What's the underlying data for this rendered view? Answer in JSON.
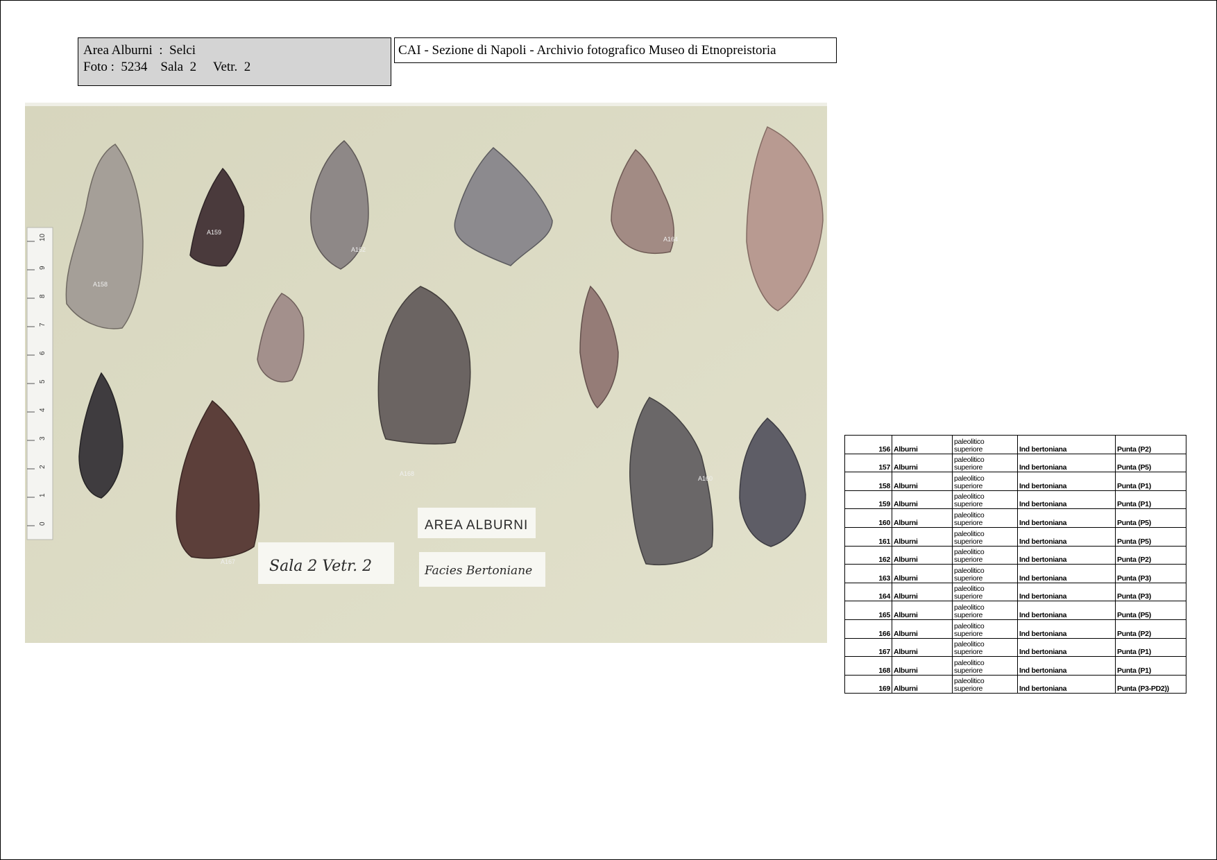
{
  "header": {
    "area_line": {
      "area_label": "Area Alburni",
      "sep": ":",
      "material": "Selci"
    },
    "photo_line": {
      "foto_label": "Foto :",
      "foto_num": "5234",
      "sala_label": "Sala",
      "sala_num": "2",
      "vetr_label": "Vetr.",
      "vetr_num": "2"
    },
    "archive": "CAI - Sezione di Napoli  - Archivio fotografico Museo di Etnopreistoria"
  },
  "photo": {
    "labels": {
      "card_area": "AREA ALBURNI",
      "card_sala": "Sala 2  Vetr. 2",
      "card_facies": "Facies Bertoniane"
    },
    "ruler_ticks": [
      "0",
      "1",
      "2",
      "3",
      "4",
      "5",
      "6",
      "7",
      "8",
      "9",
      "10"
    ],
    "artifact_codes": [
      "A158",
      "A159",
      "A162",
      "A164",
      "A167",
      "A168",
      "A160"
    ]
  },
  "catalog": {
    "rows": [
      {
        "num": "156",
        "site": "Alburni",
        "period_a": "paleolitico",
        "period_b": "superiore",
        "industry": "Ind bertoniana",
        "type": "Punta (P2)"
      },
      {
        "num": "157",
        "site": "Alburni",
        "period_a": "paleolitico",
        "period_b": "superiore",
        "industry": "Ind bertoniana",
        "type": "Punta (P5)"
      },
      {
        "num": "158",
        "site": "Alburni",
        "period_a": "paleolitico",
        "period_b": "superiore",
        "industry": "Ind bertoniana",
        "type": "Punta (P1)"
      },
      {
        "num": "159",
        "site": "Alburni",
        "period_a": "paleolitico",
        "period_b": "superiore",
        "industry": "Ind bertoniana",
        "type": "Punta (P1)"
      },
      {
        "num": "160",
        "site": "Alburni",
        "period_a": "paleolitico",
        "period_b": "superiore",
        "industry": "Ind bertoniana",
        "type": "Punta (P5)"
      },
      {
        "num": "161",
        "site": "Alburni",
        "period_a": "paleolitico",
        "period_b": "superiore",
        "industry": "Ind bertoniana",
        "type": "Punta (P5)"
      },
      {
        "num": "162",
        "site": "Alburni",
        "period_a": "paleolitico",
        "period_b": "superiore",
        "industry": "Ind bertoniana",
        "type": "Punta (P2)"
      },
      {
        "num": "163",
        "site": "Alburni",
        "period_a": "paleolitico",
        "period_b": "superiore",
        "industry": "Ind bertoniana",
        "type": "Punta (P3)"
      },
      {
        "num": "164",
        "site": "Alburni",
        "period_a": "paleolitico",
        "period_b": "superiore",
        "industry": "Ind bertoniana",
        "type": "Punta (P3)"
      },
      {
        "num": "165",
        "site": "Alburni",
        "period_a": "paleolitico",
        "period_b": "superiore",
        "industry": "Ind bertoniana",
        "type": "Punta (P5)"
      },
      {
        "num": "166",
        "site": "Alburni",
        "period_a": "paleolitico",
        "period_b": "superiore",
        "industry": "Ind bertoniana",
        "type": "Punta (P2)"
      },
      {
        "num": "167",
        "site": "Alburni",
        "period_a": "paleolitico",
        "period_b": "superiore",
        "industry": "Ind bertoniana",
        "type": "Punta (P1)"
      },
      {
        "num": "168",
        "site": "Alburni",
        "period_a": "paleolitico",
        "period_b": "superiore",
        "industry": "Ind bertoniana",
        "type": "Punta (P1)"
      },
      {
        "num": "169",
        "site": "Alburni",
        "period_a": "paleolitico",
        "period_b": "superiore",
        "industry": "Ind bertoniana",
        "type": "Punta (P3-PD2))"
      }
    ]
  }
}
